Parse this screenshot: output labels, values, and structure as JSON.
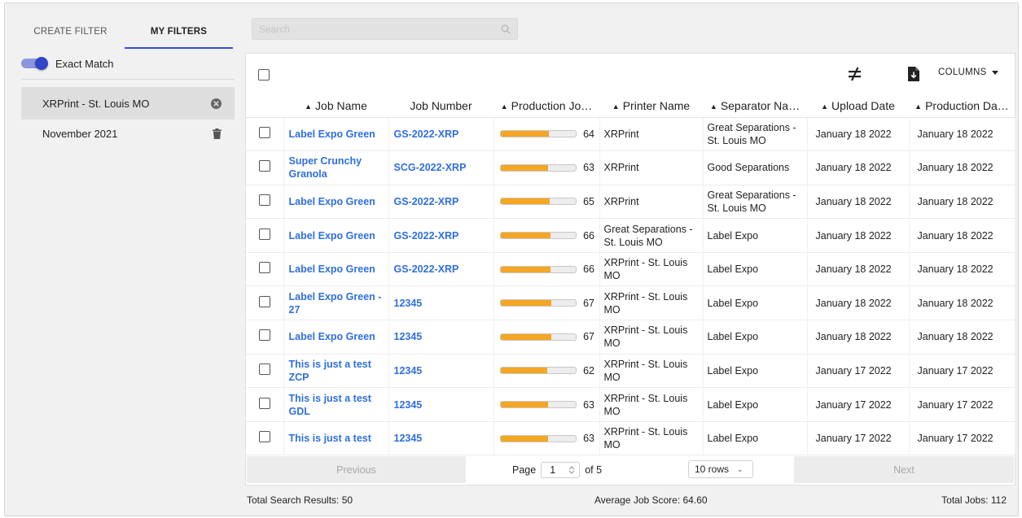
{
  "sidebar": {
    "tabs": [
      {
        "label": "CREATE FILTER",
        "active": false
      },
      {
        "label": "MY FILTERS",
        "active": true
      }
    ],
    "exact_match": {
      "label": "Exact Match",
      "on": true
    },
    "filters": [
      {
        "label": "XRPrint - St. Louis MO",
        "icon": "close-circle-icon",
        "selected": true
      },
      {
        "label": "November 2021",
        "icon": "trash-icon",
        "selected": false
      }
    ]
  },
  "search": {
    "placeholder": "Search",
    "value": ""
  },
  "toolbar": {
    "columns_label": "COLUMNS",
    "compare_icon": "not-equal-icon",
    "export_icon": "file-download-icon"
  },
  "table": {
    "headers": [
      "Job Name",
      "Job Number",
      "Production Jo…",
      "Printer Name",
      "Separator Na…",
      "Upload Date",
      "Production Da…"
    ],
    "sortable": [
      true,
      false,
      true,
      true,
      true,
      true,
      true
    ],
    "rows": [
      {
        "job_name": "Label Expo Green",
        "job_number": "GS-2022-XRP",
        "score": 64,
        "printer": "XRPrint",
        "separator": "Great Separations - St. Louis MO",
        "upload_date": "January 18 2022",
        "production_date": "January 18 2022"
      },
      {
        "job_name": "Super Crunchy Granola",
        "job_number": "SCG-2022-XRP",
        "score": 63,
        "printer": "XRPrint",
        "separator": "Good Separations",
        "upload_date": "January 18 2022",
        "production_date": "January 18 2022"
      },
      {
        "job_name": "Label Expo Green",
        "job_number": "GS-2022-XRP",
        "score": 65,
        "printer": "XRPrint",
        "separator": "Great Separations - St. Louis MO",
        "upload_date": "January 18 2022",
        "production_date": "January 18 2022"
      },
      {
        "job_name": "Label Expo Green",
        "job_number": "GS-2022-XRP",
        "score": 66,
        "printer": "Great Separations - St. Louis MO",
        "separator": "Label Expo",
        "upload_date": "January 18 2022",
        "production_date": "January 18 2022"
      },
      {
        "job_name": "Label Expo Green",
        "job_number": "GS-2022-XRP",
        "score": 66,
        "printer": "XRPrint - St. Louis MO",
        "separator": "Label Expo",
        "upload_date": "January 18 2022",
        "production_date": "January 18 2022"
      },
      {
        "job_name": "Label Expo Green - 27",
        "job_number": "12345",
        "score": 67,
        "printer": "XRPrint - St. Louis MO",
        "separator": "Label Expo",
        "upload_date": "January 18 2022",
        "production_date": "January 18 2022"
      },
      {
        "job_name": "Label Expo Green",
        "job_number": "12345",
        "score": 67,
        "printer": "XRPrint - St. Louis MO",
        "separator": "Label Expo",
        "upload_date": "January 18 2022",
        "production_date": "January 18 2022"
      },
      {
        "job_name": "This is just a test ZCP",
        "job_number": "12345",
        "score": 62,
        "printer": "XRPrint - St. Louis MO",
        "separator": "Label Expo",
        "upload_date": "January 17 2022",
        "production_date": "January 17 2022"
      },
      {
        "job_name": "This is just a test GDL",
        "job_number": "12345",
        "score": 63,
        "printer": "XRPrint - St. Louis MO",
        "separator": "Label Expo",
        "upload_date": "January 17 2022",
        "production_date": "January 17 2022"
      },
      {
        "job_name": "This is just a test",
        "job_number": "12345",
        "score": 63,
        "printer": "XRPrint - St. Louis MO",
        "separator": "Label Expo",
        "upload_date": "January 17 2022",
        "production_date": "January 17 2022"
      }
    ]
  },
  "pagination": {
    "previous_label": "Previous",
    "next_label": "Next",
    "page_label": "Page",
    "page": "1",
    "of_label": "of 5",
    "rows_label": "10 rows"
  },
  "footer": {
    "total_results": "Total Search Results: 50",
    "average_score": "Average Job Score: 64.60",
    "total_jobs": "Total Jobs: 112"
  },
  "colors": {
    "accent": "#3b4bd8",
    "link": "#2f6fe0",
    "progress": "#f5a623"
  }
}
